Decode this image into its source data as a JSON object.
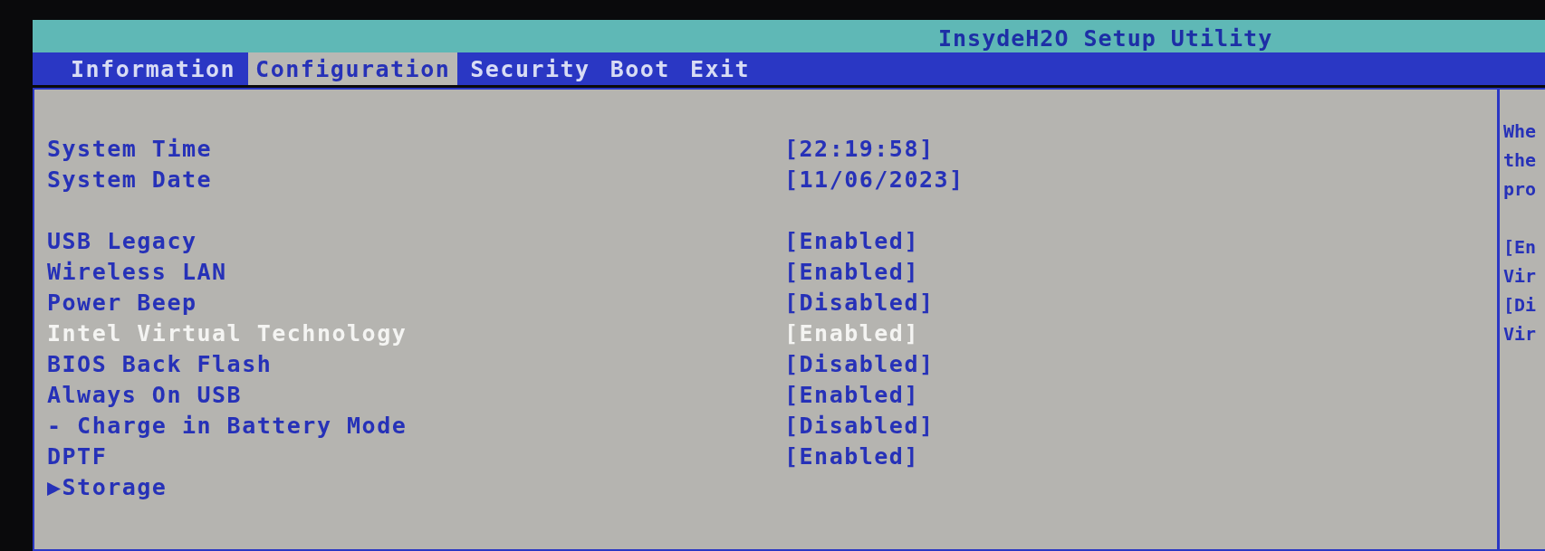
{
  "window": {
    "title": "InsydeH2O Setup Utility"
  },
  "tabs": [
    {
      "label": "Information",
      "selected": false
    },
    {
      "label": "Configuration",
      "selected": true
    },
    {
      "label": "Security",
      "selected": false
    },
    {
      "label": "Boot",
      "selected": false
    },
    {
      "label": "Exit",
      "selected": false
    }
  ],
  "groups": [
    {
      "items": [
        {
          "label": "System Time",
          "value": "[22:19:58]",
          "selected": false,
          "kind": "setting"
        },
        {
          "label": "System Date",
          "value": "[11/06/2023]",
          "selected": false,
          "kind": "setting"
        }
      ]
    },
    {
      "items": [
        {
          "label": "USB Legacy",
          "value": "[Enabled]",
          "selected": false,
          "kind": "setting"
        },
        {
          "label": "Wireless LAN",
          "value": "[Enabled]",
          "selected": false,
          "kind": "setting"
        },
        {
          "label": "Power Beep",
          "value": "[Disabled]",
          "selected": false,
          "kind": "setting"
        },
        {
          "label": "Intel Virtual Technology",
          "value": "[Enabled]",
          "selected": true,
          "kind": "setting"
        },
        {
          "label": "BIOS Back Flash",
          "value": "[Disabled]",
          "selected": false,
          "kind": "setting"
        },
        {
          "label": "Always On USB",
          "value": "[Enabled]",
          "selected": false,
          "kind": "setting"
        },
        {
          "label": "- Charge in Battery Mode",
          "value": "[Disabled]",
          "selected": false,
          "kind": "setting"
        },
        {
          "label": "DPTF",
          "value": "[Enabled]",
          "selected": false,
          "kind": "setting"
        },
        {
          "label": "Storage",
          "marker": "▶",
          "selected": false,
          "kind": "submenu"
        }
      ]
    }
  ],
  "help": {
    "paragraphs": [
      {
        "lines": [
          "Whe",
          "the",
          "pro"
        ]
      },
      {
        "lines": [
          "[En",
          "Vir",
          "[Di",
          "Vir"
        ]
      }
    ]
  }
}
